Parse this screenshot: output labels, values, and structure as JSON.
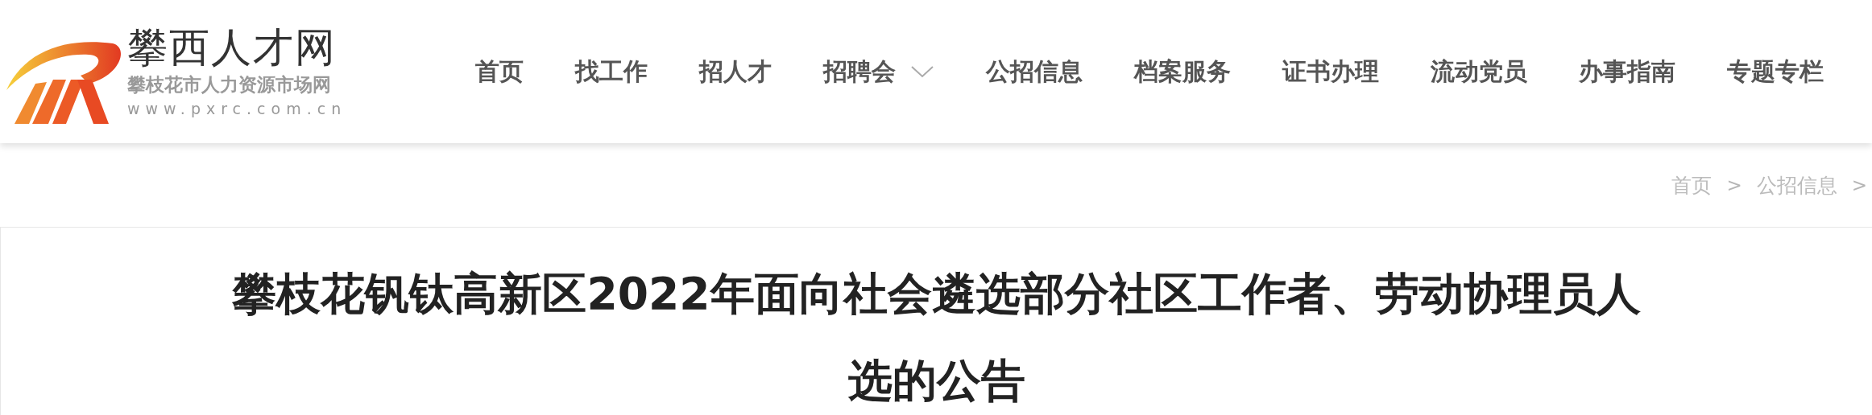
{
  "logo": {
    "title": "攀西人才网",
    "subtitle": "攀枝花市人力资源市场网",
    "url": "www.pxrc.com.cn"
  },
  "nav": [
    {
      "label": "首页",
      "kind": "link"
    },
    {
      "label": "找工作",
      "kind": "link"
    },
    {
      "label": "招人才",
      "kind": "link"
    },
    {
      "label": "招聘会",
      "kind": "dropdown"
    },
    {
      "label": "公招信息",
      "kind": "link"
    },
    {
      "label": "档案服务",
      "kind": "link"
    },
    {
      "label": "证书办理",
      "kind": "link"
    },
    {
      "label": "流动党员",
      "kind": "link"
    },
    {
      "label": "办事指南",
      "kind": "link"
    },
    {
      "label": "专题专栏",
      "kind": "link"
    }
  ],
  "breadcrumb": [
    {
      "label": "首页",
      "kind": "link"
    },
    {
      "label": ">",
      "kind": "separator"
    },
    {
      "label": "公招信息",
      "kind": "link"
    },
    {
      "label": ">",
      "kind": "separator"
    }
  ],
  "article": {
    "title": "攀枝花钒钛高新区2022年面向社会遴选部分社区工作者、劳动协理员人选的公告"
  }
}
